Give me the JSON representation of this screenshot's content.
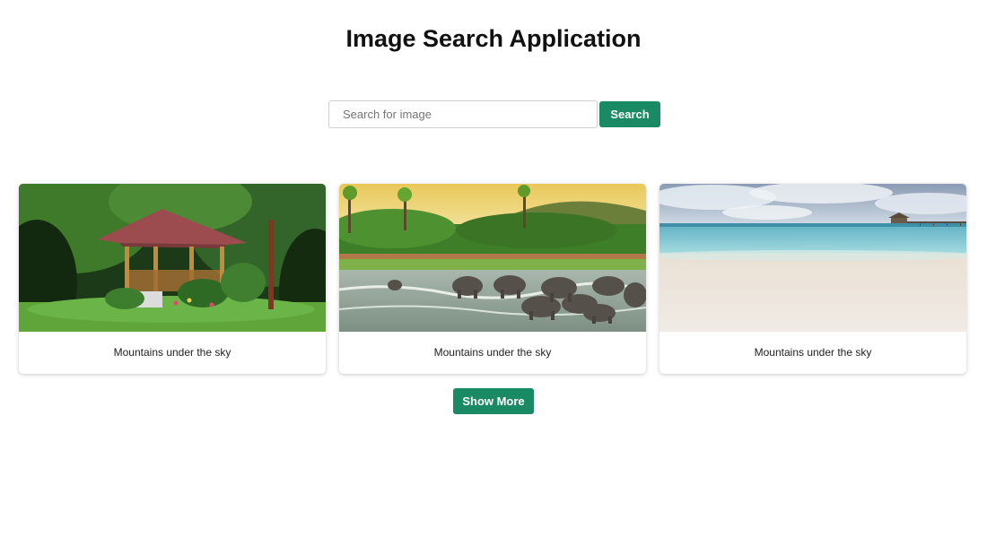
{
  "app": {
    "title": "Image Search Application"
  },
  "search": {
    "placeholder": "Search for image",
    "value": "",
    "button_label": "Search"
  },
  "results": [
    {
      "caption": "Mountains under the sky"
    },
    {
      "caption": "Mountains under the sky"
    },
    {
      "caption": "Mountains under the sky"
    }
  ],
  "show_more_label": "Show More",
  "colors": {
    "accent": "#1a8a65",
    "background": "#ffffff",
    "title_text": "#111111"
  }
}
